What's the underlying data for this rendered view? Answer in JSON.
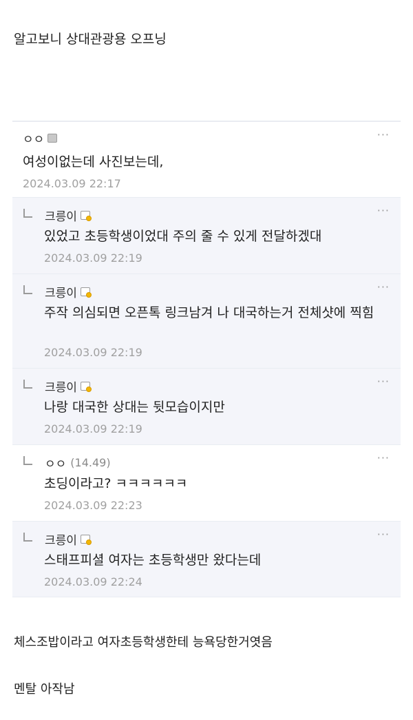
{
  "post": {
    "title": "알고보니 상대관광용 오프닝",
    "after_text_1": "체스조밥이라고 여자초등학생한테 능욕당한거엿음",
    "after_text_2": "멘탈 아작남"
  },
  "comments": [
    {
      "author": "ㅇㅇ",
      "score": "",
      "body": "여성이없는데 사진보는데,",
      "time": "2024.03.09 22:17",
      "icon": "mobile-icon",
      "more": "···"
    },
    {
      "author": "크릉이",
      "score": "",
      "body": "있었고 초등학생이었대 주의 줄 수 있게 전달하겠대",
      "time": "2024.03.09 22:19",
      "icon": "fixed-nick-icon",
      "more": "···"
    },
    {
      "author": "크릉이",
      "score": "",
      "body": "주작 의심되면 오픈톡 링크남겨 나 대국하는거 전체샷에 찍힘",
      "time": "2024.03.09 22:19",
      "icon": "fixed-nick-icon",
      "more": "···"
    },
    {
      "author": "크릉이",
      "score": "",
      "body": "나랑 대국한 상대는 뒷모습이지만",
      "time": "2024.03.09 22:19",
      "icon": "fixed-nick-icon",
      "more": "···"
    },
    {
      "author": "ㅇㅇ",
      "score": "(14.49)",
      "body": "초딩이라고? ㅋㅋㅋㅋㅋㅋ",
      "time": "2024.03.09 22:23",
      "icon": "",
      "more": "···"
    },
    {
      "author": "크릉이",
      "score": "",
      "body": "스태프피셜 여자는 초등학생만 왔다는데",
      "time": "2024.03.09 22:24",
      "icon": "fixed-nick-icon",
      "more": "···"
    }
  ],
  "colors": {
    "reply_background": "#f4f5fa",
    "border": "#e9ecf2",
    "timestamp": "#a0a0a0",
    "badge_accent": "#f2b705"
  }
}
